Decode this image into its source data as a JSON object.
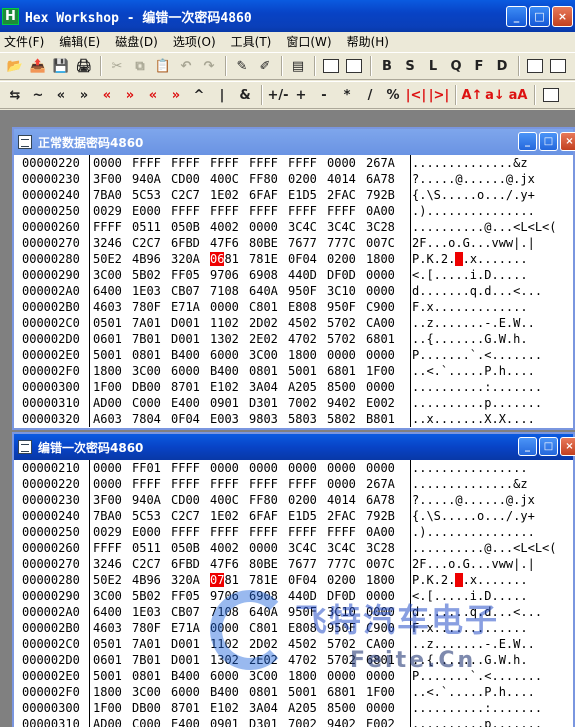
{
  "window": {
    "title": "Hex Workshop - 编错一次密码4860",
    "logo_letter": "H",
    "minimize": "_",
    "maximize": "□",
    "close": "×"
  },
  "menu": [
    "文件(F)",
    "编辑(E)",
    "磁盘(D)",
    "选项(O)",
    "工具(T)",
    "窗口(W)",
    "帮助(H)"
  ],
  "toolbar1_letters": [
    "B",
    "S",
    "L",
    "Q",
    "F",
    "D"
  ],
  "toolbar2_symbols": [
    "⇆",
    "~",
    "«",
    "»",
    "«",
    "»",
    "«",
    "»",
    "^",
    "|",
    "&",
    "+/-",
    "+",
    "-",
    "*",
    "/",
    "%",
    "|<|",
    "|>|",
    "A↑",
    "a↓",
    "aA"
  ],
  "child1": {
    "title": "正常数据密码4860",
    "highlight_row": 6,
    "highlight_word": 3,
    "rows": [
      {
        "addr": "00000220",
        "words": [
          "0000",
          "FFFF",
          "FFFF",
          "FFFF",
          "FFFF",
          "FFFF",
          "0000",
          "267A"
        ],
        "ascii": "..............&z"
      },
      {
        "addr": "00000230",
        "words": [
          "3F00",
          "940A",
          "CD00",
          "400C",
          "FF80",
          "0200",
          "4014",
          "6A78"
        ],
        "ascii": "?.....@......@.jx"
      },
      {
        "addr": "00000240",
        "words": [
          "7BA0",
          "5C53",
          "C2C7",
          "1E02",
          "6FAF",
          "E1D5",
          "2FAC",
          "792B"
        ],
        "ascii": "{.\\S.....o.../.y+"
      },
      {
        "addr": "00000250",
        "words": [
          "0029",
          "E000",
          "FFFF",
          "FFFF",
          "FFFF",
          "FFFF",
          "FFFF",
          "0A00"
        ],
        "ascii": ".)..............."
      },
      {
        "addr": "00000260",
        "words": [
          "FFFF",
          "0511",
          "050B",
          "4002",
          "0000",
          "3C4C",
          "3C4C",
          "3C28"
        ],
        "ascii": "..........@...<L<L<("
      },
      {
        "addr": "00000270",
        "words": [
          "3246",
          "C2C7",
          "6FBD",
          "47F6",
          "80BE",
          "7677",
          "777C",
          "007C"
        ],
        "ascii": "2F...o.G...vww|.|"
      },
      {
        "addr": "00000280",
        "words": [
          "50E2",
          "4B96",
          "320A",
          "0681",
          "781E",
          "0F04",
          "0200",
          "1800"
        ],
        "ascii": "P.K.2...x......."
      },
      {
        "addr": "00000290",
        "words": [
          "3C00",
          "5B02",
          "FF05",
          "9706",
          "6908",
          "440D",
          "DF0D",
          "0000"
        ],
        "ascii": "<.[.....i.D....."
      },
      {
        "addr": "000002A0",
        "words": [
          "6400",
          "1E03",
          "CB07",
          "7108",
          "640A",
          "950F",
          "3C10",
          "0000"
        ],
        "ascii": "d.......q.d...<..."
      },
      {
        "addr": "000002B0",
        "words": [
          "4603",
          "780F",
          "E71A",
          "0000",
          "C801",
          "E808",
          "950F",
          "C900"
        ],
        "ascii": "F.x............."
      },
      {
        "addr": "000002C0",
        "words": [
          "0501",
          "7A01",
          "D001",
          "1102",
          "2D02",
          "4502",
          "5702",
          "CA00"
        ],
        "ascii": "..z.......-.E.W.."
      },
      {
        "addr": "000002D0",
        "words": [
          "0601",
          "7B01",
          "D001",
          "1302",
          "2E02",
          "4702",
          "5702",
          "6801"
        ],
        "ascii": "..{.......G.W.h."
      },
      {
        "addr": "000002E0",
        "words": [
          "5001",
          "0801",
          "B400",
          "6000",
          "3C00",
          "1800",
          "0000",
          "0000"
        ],
        "ascii": "P.......`.<......."
      },
      {
        "addr": "000002F0",
        "words": [
          "1800",
          "3C00",
          "6000",
          "B400",
          "0801",
          "5001",
          "6801",
          "1F00"
        ],
        "ascii": "..<.`.....P.h...."
      },
      {
        "addr": "00000300",
        "words": [
          "1F00",
          "DB00",
          "8701",
          "E102",
          "3A04",
          "A205",
          "8500",
          "0000"
        ],
        "ascii": "..........:......."
      },
      {
        "addr": "00000310",
        "words": [
          "AD00",
          "C000",
          "E400",
          "0901",
          "D301",
          "7002",
          "9402",
          "E002"
        ],
        "ascii": "..........p......."
      },
      {
        "addr": "00000320",
        "words": [
          "A603",
          "7804",
          "0F04",
          "E003",
          "9803",
          "5803",
          "5802",
          "B801"
        ],
        "ascii": "..x.......X.X...."
      }
    ]
  },
  "child2": {
    "title": "编错一次密码4860",
    "highlight_row": 7,
    "highlight_word": 3,
    "rows": [
      {
        "addr": "00000210",
        "words": [
          "0000",
          "FF01",
          "FFFF",
          "0000",
          "0000",
          "0000",
          "0000",
          "0000"
        ],
        "ascii": "................"
      },
      {
        "addr": "00000220",
        "words": [
          "0000",
          "FFFF",
          "FFFF",
          "FFFF",
          "FFFF",
          "FFFF",
          "0000",
          "267A"
        ],
        "ascii": "..............&z"
      },
      {
        "addr": "00000230",
        "words": [
          "3F00",
          "940A",
          "CD00",
          "400C",
          "FF80",
          "0200",
          "4014",
          "6A78"
        ],
        "ascii": "?.....@......@.jx"
      },
      {
        "addr": "00000240",
        "words": [
          "7BA0",
          "5C53",
          "C2C7",
          "1E02",
          "6FAF",
          "E1D5",
          "2FAC",
          "792B"
        ],
        "ascii": "{.\\S.....o.../.y+"
      },
      {
        "addr": "00000250",
        "words": [
          "0029",
          "E000",
          "FFFF",
          "FFFF",
          "FFFF",
          "FFFF",
          "FFFF",
          "0A00"
        ],
        "ascii": ".)..............."
      },
      {
        "addr": "00000260",
        "words": [
          "FFFF",
          "0511",
          "050B",
          "4002",
          "0000",
          "3C4C",
          "3C4C",
          "3C28"
        ],
        "ascii": "..........@...<L<L<("
      },
      {
        "addr": "00000270",
        "words": [
          "3246",
          "C2C7",
          "6FBD",
          "47F6",
          "80BE",
          "7677",
          "777C",
          "007C"
        ],
        "ascii": "2F...o.G...vww|.|"
      },
      {
        "addr": "00000280",
        "words": [
          "50E2",
          "4B96",
          "320A",
          "0781",
          "781E",
          "0F04",
          "0200",
          "1800"
        ],
        "ascii": "P.K.2...x......."
      },
      {
        "addr": "00000290",
        "words": [
          "3C00",
          "5B02",
          "FF05",
          "9706",
          "6908",
          "440D",
          "DF0D",
          "0000"
        ],
        "ascii": "<.[.....i.D....."
      },
      {
        "addr": "000002A0",
        "words": [
          "6400",
          "1E03",
          "CB07",
          "7108",
          "640A",
          "950F",
          "3C10",
          "0000"
        ],
        "ascii": "d.......q.d...<..."
      },
      {
        "addr": "000002B0",
        "words": [
          "4603",
          "780F",
          "E71A",
          "0000",
          "C801",
          "E808",
          "950F",
          "C900"
        ],
        "ascii": "F.x............."
      },
      {
        "addr": "000002C0",
        "words": [
          "0501",
          "7A01",
          "D001",
          "1102",
          "2D02",
          "4502",
          "5702",
          "CA00"
        ],
        "ascii": "..z.......-.E.W.."
      },
      {
        "addr": "000002D0",
        "words": [
          "0601",
          "7B01",
          "D001",
          "1302",
          "2E02",
          "4702",
          "5702",
          "6801"
        ],
        "ascii": "..{.......G.W.h."
      },
      {
        "addr": "000002E0",
        "words": [
          "5001",
          "0801",
          "B400",
          "6000",
          "3C00",
          "1800",
          "0000",
          "0000"
        ],
        "ascii": "P.......`.<......."
      },
      {
        "addr": "000002F0",
        "words": [
          "1800",
          "3C00",
          "6000",
          "B400",
          "0801",
          "5001",
          "6801",
          "1F00"
        ],
        "ascii": "..<.`.....P.h...."
      },
      {
        "addr": "00000300",
        "words": [
          "1F00",
          "DB00",
          "8701",
          "E102",
          "3A04",
          "A205",
          "8500",
          "0000"
        ],
        "ascii": "..........:......."
      },
      {
        "addr": "00000310",
        "words": [
          "AD00",
          "C000",
          "E400",
          "0901",
          "D301",
          "7002",
          "9402",
          "E002"
        ],
        "ascii": "..........p......."
      }
    ]
  },
  "watermark": {
    "cn": "飞特汽车电子",
    "en": "Feite.Cn"
  },
  "colors": {
    "highlight": "#e00000",
    "titlebar": "#0a5be0"
  }
}
